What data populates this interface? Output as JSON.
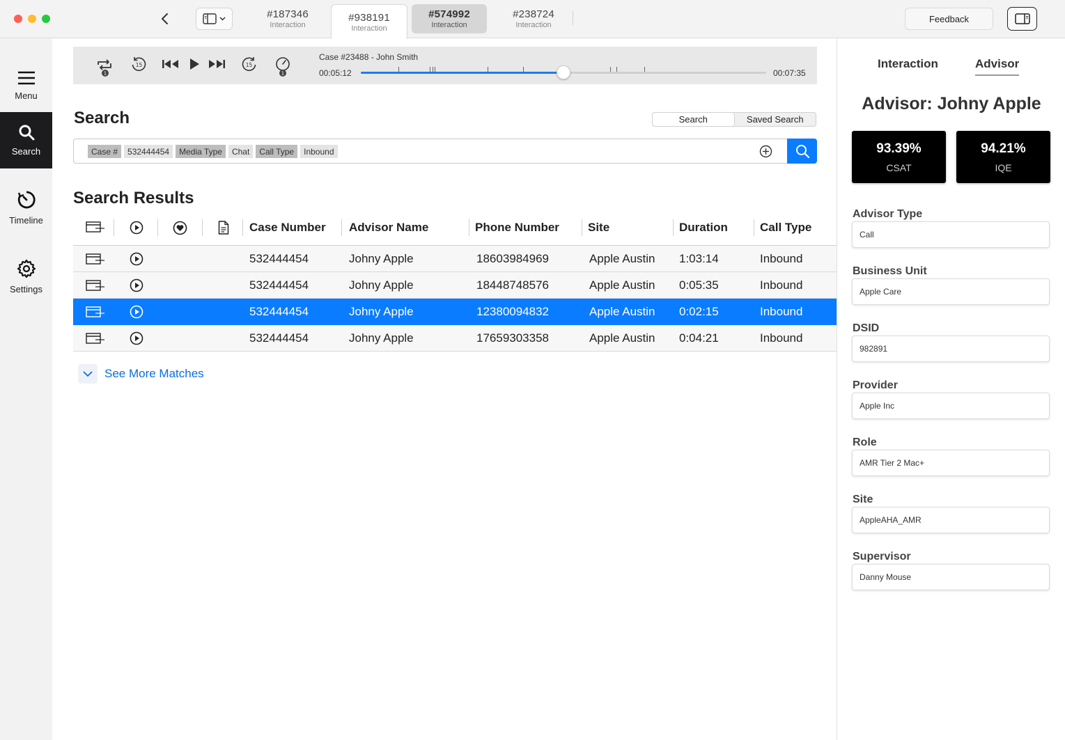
{
  "window": {
    "tabs": [
      {
        "number": "#187346",
        "label": "Interaction"
      },
      {
        "number": "#938191",
        "label": "Interaction"
      },
      {
        "number": "#574992",
        "label": "Interaction"
      },
      {
        "number": "#238724",
        "label": "Interaction"
      }
    ],
    "feedback_label": "Feedback"
  },
  "nav": {
    "items": [
      {
        "label": "Menu",
        "icon": "hamburger-icon"
      },
      {
        "label": "Search",
        "icon": "search-icon"
      },
      {
        "label": "Timeline",
        "icon": "timeline-icon"
      },
      {
        "label": "Settings",
        "icon": "gear-icon"
      }
    ],
    "active": "Search"
  },
  "player": {
    "case_title": "Case #23488 - John Smith",
    "current_time": "00:05:12",
    "total_time": "00:07:35",
    "progress": 0.5,
    "skip_back_seconds": "15",
    "skip_forward_seconds": "15",
    "loop_badge": "1",
    "speed_badge": "1"
  },
  "search": {
    "heading": "Search",
    "modes": [
      "Search",
      "Saved Search"
    ],
    "active_mode": "Search",
    "filters": [
      {
        "key": "Case #",
        "value": "532444454"
      },
      {
        "key": "Media Type",
        "value": "Chat"
      },
      {
        "key": "Call Type",
        "value": "Inbound"
      }
    ]
  },
  "results": {
    "heading": "Search Results",
    "columns": [
      "Case Number",
      "Advisor Name",
      "Phone Number",
      "Site",
      "Duration",
      "Call Type"
    ],
    "rows": [
      {
        "case": "532444454",
        "advisor": "Johny Apple",
        "phone": "18603984969",
        "site": "Apple Austin",
        "duration": "1:03:14",
        "call_type": "Inbound",
        "selected": false
      },
      {
        "case": "532444454",
        "advisor": "Johny Apple",
        "phone": "18448748576",
        "site": "Apple Austin",
        "duration": "0:05:35",
        "call_type": "Inbound",
        "selected": false
      },
      {
        "case": "532444454",
        "advisor": "Johny Apple",
        "phone": "12380094832",
        "site": "Apple Austin",
        "duration": "0:02:15",
        "call_type": "Inbound",
        "selected": true
      },
      {
        "case": "532444454",
        "advisor": "Johny Apple",
        "phone": "17659303358",
        "site": "Apple Austin",
        "duration": "0:04:21",
        "call_type": "Inbound",
        "selected": false
      }
    ],
    "see_more": "See More Matches"
  },
  "panel": {
    "tabs": [
      "Interaction",
      "Advisor"
    ],
    "active_tab": "Advisor",
    "title": "Advisor: Johny Apple",
    "metrics": [
      {
        "value": "93.39%",
        "label": "CSAT"
      },
      {
        "value": "94.21%",
        "label": "IQE"
      }
    ],
    "fields": [
      {
        "label": "Advisor Type",
        "value": "Call"
      },
      {
        "label": "Business Unit",
        "value": "Apple Care"
      },
      {
        "label": "DSID",
        "value": "982891"
      },
      {
        "label": "Provider",
        "value": "Apple Inc"
      },
      {
        "label": "Role",
        "value": "AMR Tier 2 Mac+"
      },
      {
        "label": "Site",
        "value": "AppleAHA_AMR"
      },
      {
        "label": "Supervisor",
        "value": "Danny Mouse"
      }
    ]
  },
  "colors": {
    "accent": "#0a7cff",
    "nav_active": "#1c1c1e",
    "metric_bg": "#000000"
  }
}
